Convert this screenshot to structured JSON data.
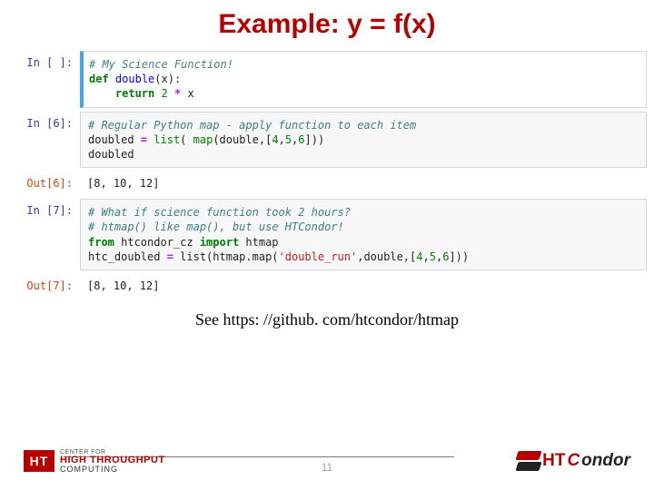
{
  "title": "Example: y = f(x)",
  "cells": {
    "in_blank": {
      "prompt": "In [ ]:",
      "comment": "# My Science Function!",
      "kw_def": "def",
      "fn": "double",
      "sig": "(x):",
      "kw_ret": "return",
      "num": "2",
      "op": "*",
      "var": "x"
    },
    "in6": {
      "prompt": "In [6]:",
      "comment": "# Regular Python map - apply function to each item",
      "lhs": "doubled ",
      "eq": "=",
      "bi_list": "list",
      "open": "( ",
      "bi_map": "map",
      "args": "(double,[",
      "n1": "4",
      "c1": ",",
      "n2": "5",
      "c2": ",",
      "n3": "6",
      "close": "]))",
      "echo": "doubled"
    },
    "out6": {
      "prompt": "Out[6]:",
      "text": "[8, 10, 12]"
    },
    "in7": {
      "prompt": "In [7]:",
      "comment1": "# What if science function took 2 hours?",
      "comment2": "# htmap() like map(), but use HTCondor!",
      "kw_from": "from",
      "mod": " htcondor_cz ",
      "kw_import": "import",
      "imp": " htmap",
      "lhs": "htc_doubled ",
      "eq": "=",
      "rhs_a": " list(htmap.map(",
      "str": "'double_run'",
      "rhs_b": ",double,[",
      "n1": "4",
      "c1": ",",
      "n2": "5",
      "c2": ",",
      "n3": "6",
      "close": "]))"
    },
    "out7": {
      "prompt": "Out[7]:",
      "text": "[8, 10, 12]"
    }
  },
  "footer_link": "See https: //github. com/htcondor/htmap",
  "page_number": "11",
  "logo_left": {
    "badge": "HT",
    "line1": "CENTER FOR",
    "line2": "HIGH THROUGHPUT",
    "line3": "COMPUTING"
  },
  "logo_right": {
    "ht": "HT",
    "c": "C",
    "rest": "ondor"
  }
}
